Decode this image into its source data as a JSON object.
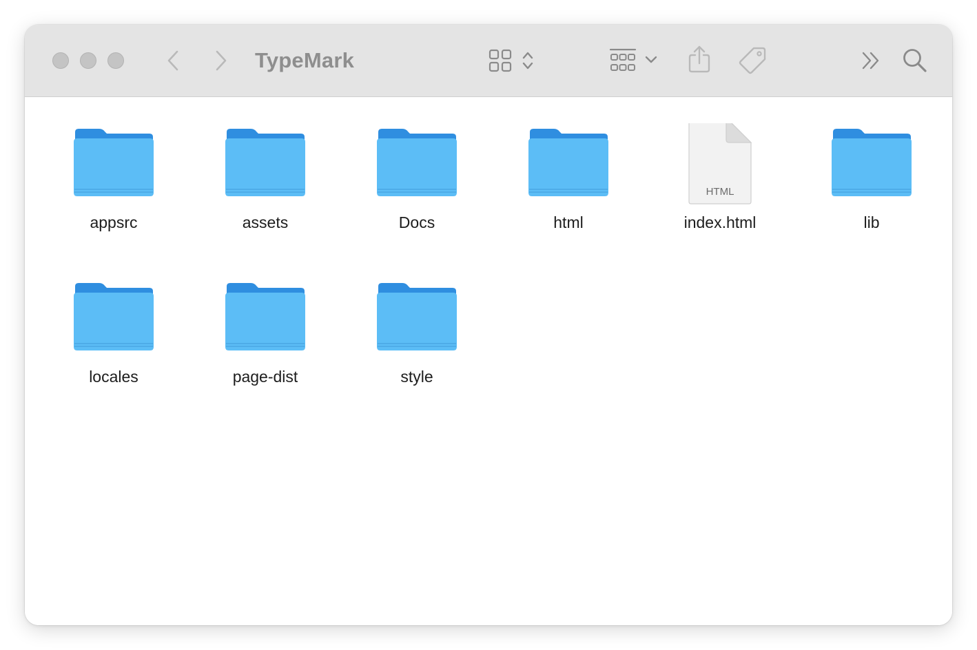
{
  "window": {
    "title": "TypeMark"
  },
  "toolbar": {
    "back_icon": "chevron-left-icon",
    "forward_icon": "chevron-right-icon",
    "view_icon": "icon-grid-view-icon",
    "group_icon": "group-by-icon",
    "share_icon": "share-icon",
    "tag_icon": "tag-icon",
    "more_icon": "double-chevron-right-icon",
    "search_icon": "magnifying-glass-icon"
  },
  "colors": {
    "folder_blue": "#5cbdf6",
    "folder_tab": "#2f8ee0",
    "toolbar_bg": "#e4e4e4"
  },
  "files": [
    {
      "name": "appsrc",
      "kind": "folder"
    },
    {
      "name": "assets",
      "kind": "folder"
    },
    {
      "name": "Docs",
      "kind": "folder"
    },
    {
      "name": "html",
      "kind": "folder"
    },
    {
      "name": "index.html",
      "kind": "html-document",
      "badge": "HTML"
    },
    {
      "name": "lib",
      "kind": "folder"
    },
    {
      "name": "locales",
      "kind": "folder"
    },
    {
      "name": "page-dist",
      "kind": "folder"
    },
    {
      "name": "style",
      "kind": "folder"
    }
  ]
}
